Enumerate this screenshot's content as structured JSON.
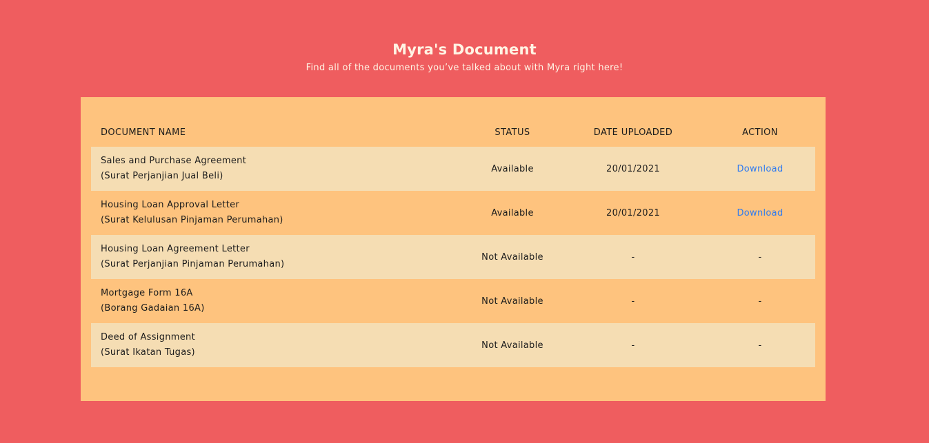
{
  "header": {
    "title": "Myra's Document",
    "subtitle": "Find all of the documents you’ve talked about with Myra right here!"
  },
  "colors": {
    "background": "#EF5D5F",
    "panel": "#FEC37E",
    "row_alt": "#F5DDB3",
    "link": "#2F7BF0",
    "header_text": "#FFF4E4"
  },
  "table": {
    "columns": [
      "DOCUMENT NAME",
      "STATUS",
      "DATE UPLOADED",
      "ACTION"
    ],
    "rows": [
      {
        "name": "Sales and Purchase Agreement",
        "alt_name": "(Surat Perjanjian Jual Beli)",
        "status": "Available",
        "date": "20/01/2021",
        "action": "Download"
      },
      {
        "name": "Housing Loan Approval Letter",
        "alt_name": "(Surat Kelulusan Pinjaman Perumahan)",
        "status": "Available",
        "date": "20/01/2021",
        "action": "Download"
      },
      {
        "name": "Housing Loan Agreement Letter",
        "alt_name": "(Surat Perjanjian Pinjaman Perumahan)",
        "status": "Not Available",
        "date": "-",
        "action": "-"
      },
      {
        "name": "Mortgage Form 16A",
        "alt_name": "(Borang Gadaian 16A)",
        "status": "Not Available",
        "date": "-",
        "action": "-"
      },
      {
        "name": "Deed of Assignment",
        "alt_name": "(Surat Ikatan Tugas)",
        "status": "Not Available",
        "date": "-",
        "action": "-"
      }
    ]
  }
}
